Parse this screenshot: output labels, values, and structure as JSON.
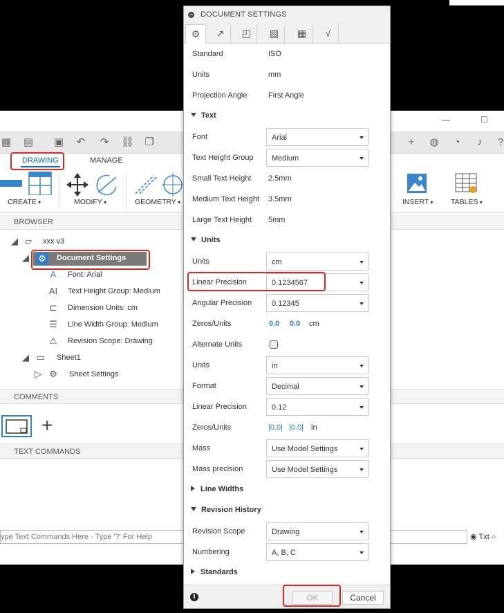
{
  "app": {
    "ribbon_tabs": [
      "DRAWING",
      "MANAGE"
    ],
    "ribbon_groups": [
      "CREATE",
      "MODIFY",
      "GEOMETRY",
      "INSERT",
      "TABLES"
    ],
    "browser_label": "BROWSER",
    "tree": {
      "root": "xxx v3",
      "document_settings": "Document Settings",
      "items": [
        "Font: Arial",
        "Text Height Group: Medium",
        "Dimension Units: cm",
        "Line Width Group: Medium",
        "Revision Scope: Drawing"
      ],
      "sheet": "Sheet1",
      "sheet_settings": "Sheet Settings"
    },
    "comments_label": "COMMENTS",
    "text_commands_label": "TEXT COMMANDS",
    "command_placeholder": "ype Text Commands Here - Type '?' For Help",
    "txt_option": "Txt"
  },
  "dialog": {
    "title": "DOCUMENT SETTINGS",
    "standard_label": "Standard",
    "standard_value": "ISO",
    "units_label": "Units",
    "units_value": "mm",
    "projection_label": "Projection Angle",
    "projection_value": "First Angle",
    "text_group": "Text",
    "font_label": "Font",
    "font_value": "Arial",
    "text_height_group_label": "Text Height Group",
    "text_height_group_value": "Medium",
    "small_text_label": "Small Text Height",
    "small_text_value": "2.5mm",
    "medium_text_label": "Medium Text Height",
    "medium_text_value": "3.5mm",
    "large_text_label": "Large Text Height",
    "large_text_value": "5mm",
    "units_group": "Units",
    "dim_units_label": "Units",
    "dim_units_value": "cm",
    "linear_precision_label": "Linear Precision",
    "linear_precision_value": "0.1234567",
    "angular_precision_label": "Angular Precision",
    "angular_precision_value": "0.12345",
    "zeros_units_label": "Zeros/Units",
    "zeros_a": "0.0",
    "zeros_b": "0.0",
    "zeros_unit": "cm",
    "alternate_units_label": "Alternate Units",
    "alt_units_label": "Units",
    "alt_units_value": "in",
    "format_label": "Format",
    "format_value": "Decimal",
    "alt_linear_precision_label": "Linear Precision",
    "alt_linear_precision_value": "0.12",
    "alt_zeros_label": "Zeros/Units",
    "alt_zeros_a": "|0.0|",
    "alt_zeros_b": "|0.0|",
    "alt_zeros_unit": "in",
    "mass_label": "Mass",
    "mass_value": "Use Model Settings",
    "mass_precision_label": "Mass precision",
    "mass_precision_value": "Use Model Settings",
    "line_widths_group": "Line Widths",
    "revision_history_group": "Revision History",
    "revision_scope_label": "Revision Scope",
    "revision_scope_value": "Drawing",
    "numbering_label": "Numbering",
    "numbering_value": "A, B, C",
    "standards_group": "Standards",
    "ok_label": "OK",
    "cancel_label": "Cancel"
  },
  "colors": {
    "highlight_red": "#e0261e",
    "accent_blue": "#2f80c9"
  }
}
